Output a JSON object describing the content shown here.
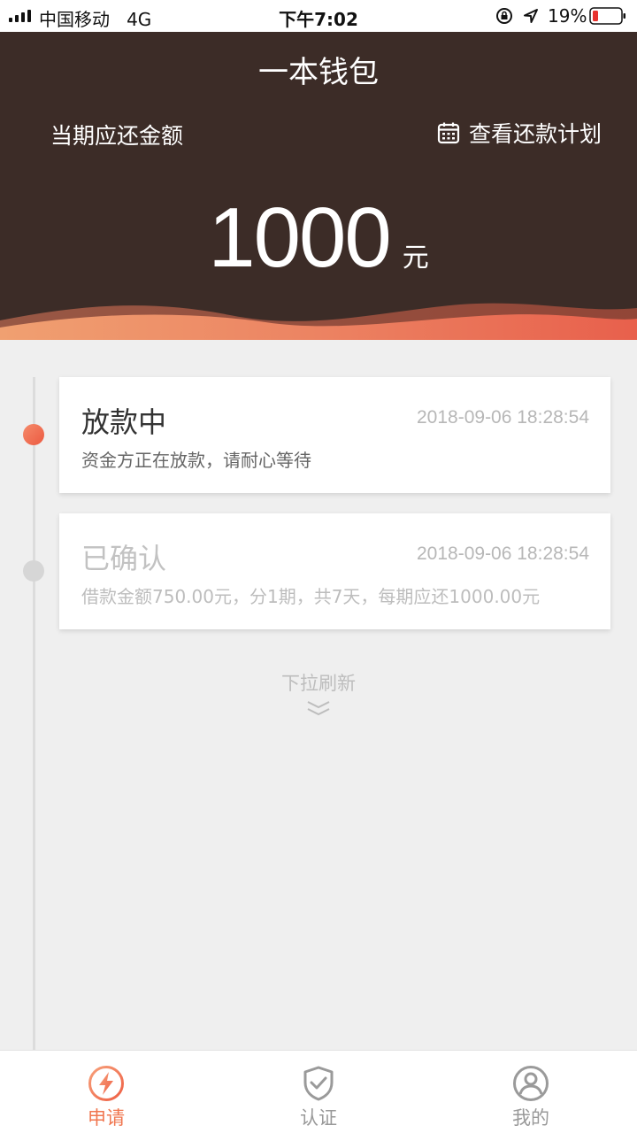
{
  "status_bar": {
    "carrier": "中国移动",
    "network": "4G",
    "time": "下午7:02",
    "battery": "19%"
  },
  "header": {
    "title": "一本钱包",
    "due_label": "当期应还金额",
    "plan_link": "查看还款计划",
    "amount": "1000",
    "unit": "元"
  },
  "timeline": [
    {
      "title": "放款中",
      "time": "2018-09-06 18:28:54",
      "desc": "资金方正在放款，请耐心等待",
      "state": "active"
    },
    {
      "title": "已确认",
      "time": "2018-09-06 18:28:54",
      "desc": "借款金额750.00元，分1期，共7天，每期应还1000.00元",
      "state": "inactive"
    }
  ],
  "pull_refresh": "下拉刷新",
  "bottom_nav": [
    {
      "label": "申请",
      "icon": "lightning-icon",
      "active": true
    },
    {
      "label": "认证",
      "icon": "shield-check-icon",
      "active": false
    },
    {
      "label": "我的",
      "icon": "user-icon",
      "active": false
    }
  ],
  "colors": {
    "header_bg": "#3c2c27",
    "accent": "#f0764f",
    "inactive": "#999999"
  }
}
